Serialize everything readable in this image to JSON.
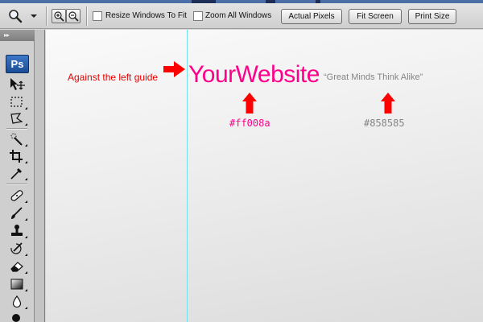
{
  "options_bar": {
    "resize_windows_label": "Resize Windows To Fit",
    "resize_windows_checked": false,
    "zoom_all_label": "Zoom All Windows",
    "zoom_all_checked": false,
    "buttons": {
      "actual_pixels": "Actual Pixels",
      "fit_screen": "Fit Screen",
      "print_size": "Print Size"
    }
  },
  "tools_panel": {
    "collapse_glyph": "▸▸",
    "logo_text": "Ps",
    "tools": [
      "move-tool",
      "rectangular-marquee-tool",
      "lasso-tool",
      "quick-selection-tool",
      "crop-tool",
      "eyedropper-tool",
      "spot-healing-brush-tool",
      "brush-tool",
      "clone-stamp-tool",
      "history-brush-tool",
      "eraser-tool",
      "gradient-tool",
      "blur-tool",
      "dodge-tool"
    ]
  },
  "canvas": {
    "annotation_text": "Against the left guide",
    "site_name": "YourWebsite",
    "tagline": "“Great Minds Think Alike”",
    "site_name_color_label": "#ff008a",
    "tagline_color_label": "#858585"
  },
  "colors": {
    "brand": "#ff008a",
    "tagline": "#858585",
    "annotation": "#e60000",
    "guide": "#6fe0ec"
  }
}
